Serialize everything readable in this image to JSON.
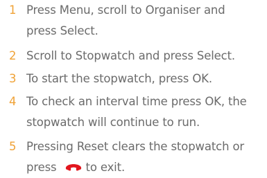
{
  "steps": [
    {
      "number": "1",
      "lines": [
        "Press Menu, scroll to Organiser and",
        "press Select."
      ]
    },
    {
      "number": "2",
      "lines": [
        "Scroll to Stopwatch and press Select."
      ]
    },
    {
      "number": "3",
      "lines": [
        "To start the stopwatch, press OK."
      ]
    },
    {
      "number": "4",
      "lines": [
        "To check an interval time press OK, the",
        "stopwatch will continue to run."
      ]
    },
    {
      "number": "5",
      "lines": [
        "Pressing Reset clears the stopwatch or"
      ],
      "last_line_before_icon": "press",
      "icon": "end-call-icon",
      "last_line_after_icon": "to exit."
    }
  ],
  "colors": {
    "step_number": "#f0a236",
    "text": "#6b6b6b",
    "icon": "#e2161e"
  }
}
